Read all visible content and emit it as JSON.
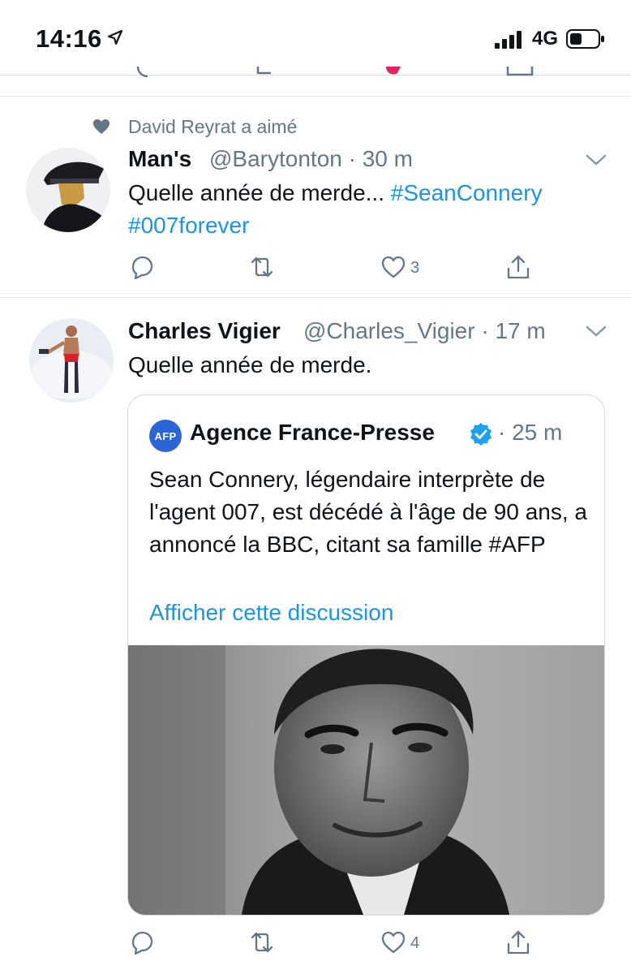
{
  "status_bar": {
    "time": "14:16",
    "network": "4G"
  },
  "tweets": [
    {
      "social_context": "David Reyrat a aimé",
      "name": "Man's",
      "meta": "@Barytonton · 30 m",
      "text": "Quelle année de merde... ",
      "hashtags": [
        "#SeanConnery",
        "#007forever"
      ],
      "likes": "3"
    },
    {
      "name": "Charles Vigier",
      "meta": "@Charles_Vigier · 17 m",
      "text": "Quelle année de merde.",
      "likes": "4",
      "quote": {
        "logo_text": "AFP",
        "name": "Agence France-Presse",
        "time": "· 25 m",
        "text": "Sean Connery, légendaire interprète de l'agent 007, est décédé à l'âge de 90 ans, a annoncé la BBC, citant sa famille #AFP",
        "link": "Afficher cette discussion"
      }
    }
  ],
  "icons": {
    "status": [
      "location-arrow-icon",
      "signal-icon",
      "battery-icon"
    ],
    "actions": [
      "reply-icon",
      "retweet-icon",
      "heart-icon",
      "share-icon"
    ],
    "other": [
      "chevron-down-icon",
      "verified-icon",
      "liked-heart-icon"
    ]
  },
  "colors": {
    "link": "#1b95e0",
    "muted": "#657786",
    "afp_blue": "#2c66d6",
    "verified": "#1da1f2"
  }
}
